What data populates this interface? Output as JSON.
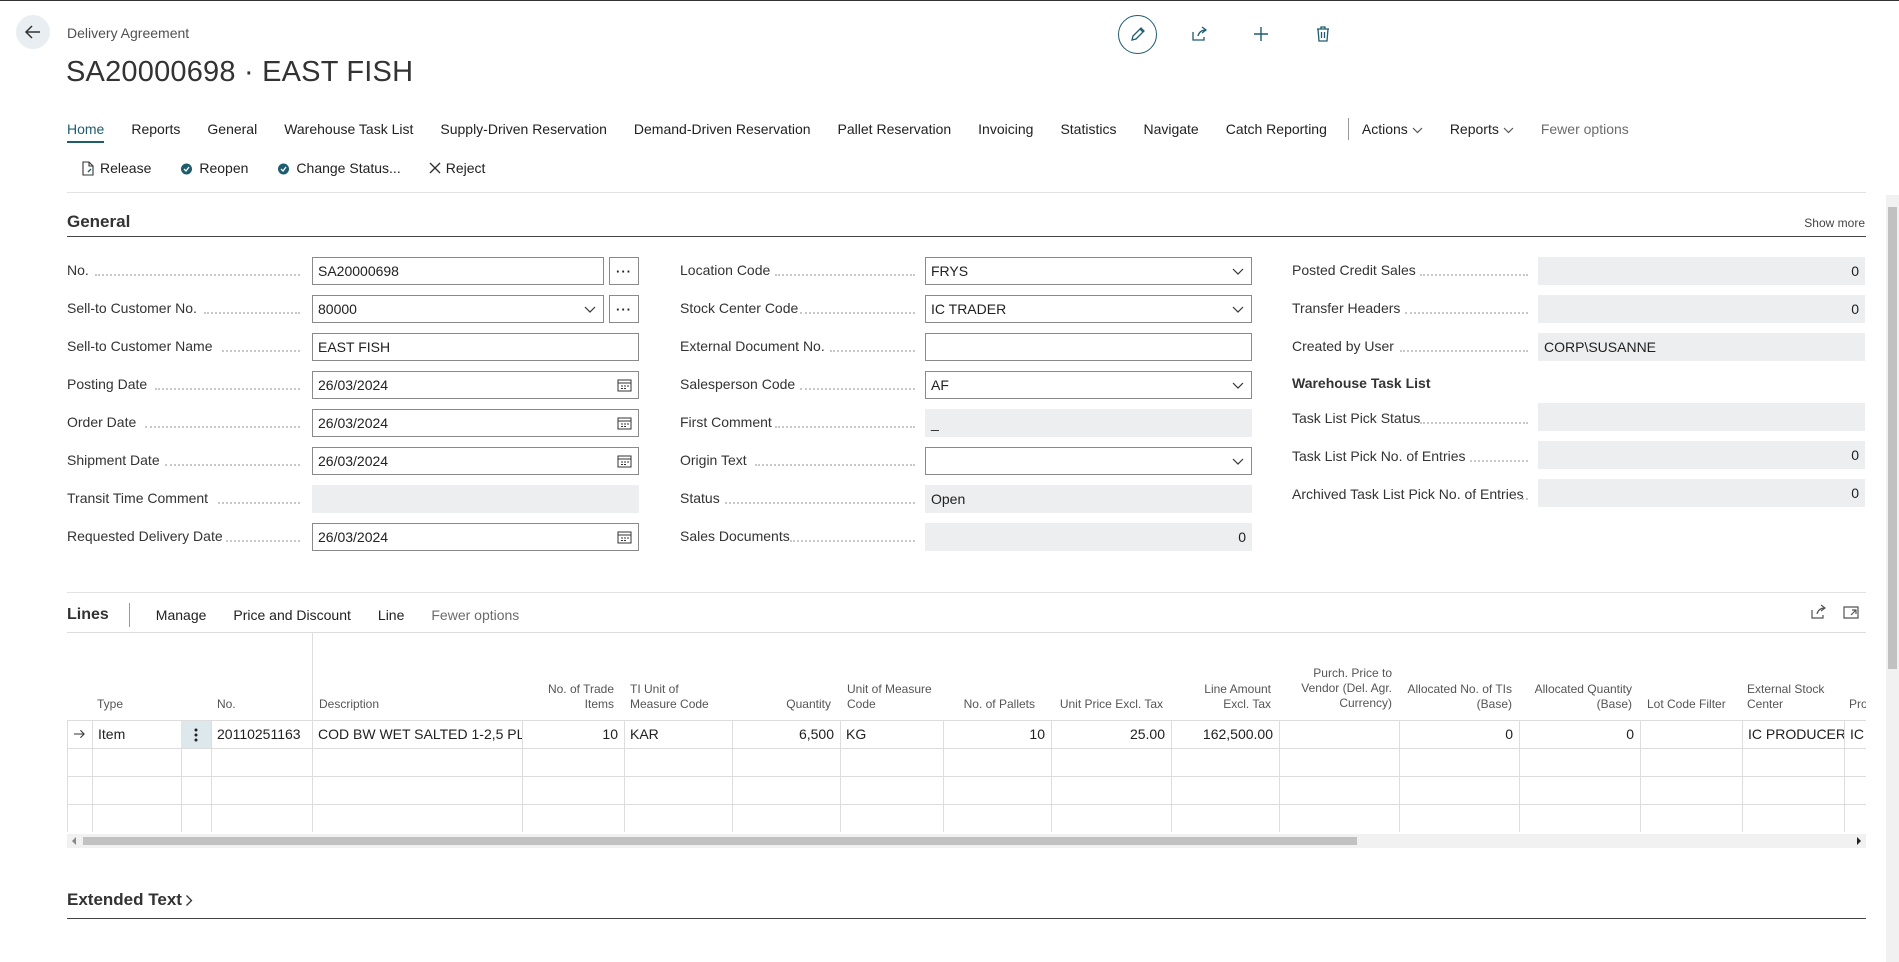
{
  "header": {
    "breadcrumb": "Delivery Agreement",
    "title": "SA20000698 · EAST FISH"
  },
  "nav": {
    "items": [
      "Home",
      "Reports",
      "General",
      "Warehouse Task List",
      "Supply-Driven Reservation",
      "Demand-Driven Reservation",
      "Pallet Reservation",
      "Invoicing",
      "Statistics",
      "Navigate",
      "Catch Reporting"
    ],
    "actions_menu": "Actions",
    "reports_menu": "Reports",
    "fewer": "Fewer options"
  },
  "actions": {
    "release": "Release",
    "reopen": "Reopen",
    "change_status": "Change Status...",
    "reject": "Reject"
  },
  "general": {
    "title": "General",
    "show_more": "Show more",
    "col1": {
      "no_label": "No.",
      "no_value": "SA20000698",
      "cust_no_label": "Sell-to Customer No.",
      "cust_no_value": "80000",
      "cust_name_label": "Sell-to Customer Name",
      "cust_name_value": "EAST FISH",
      "posting_label": "Posting Date",
      "posting_value": "26/03/2024",
      "order_label": "Order Date",
      "order_value": "26/03/2024",
      "ship_label": "Shipment Date",
      "ship_value": "26/03/2024",
      "transit_label": "Transit Time Comment",
      "transit_value": "",
      "req_label": "Requested Delivery Date",
      "req_value": "26/03/2024"
    },
    "col2": {
      "loc_label": "Location Code",
      "loc_value": "FRYS",
      "stock_label": "Stock Center Code",
      "stock_value": "IC TRADER",
      "extdoc_label": "External Document No.",
      "extdoc_value": "",
      "sales_label": "Salesperson Code",
      "sales_value": "AF",
      "comment_label": "First Comment",
      "comment_value": "_",
      "origin_label": "Origin Text",
      "origin_value": "",
      "status_label": "Status",
      "status_value": "Open",
      "salesdocs_label": "Sales Documents",
      "salesdocs_value": "0"
    },
    "col3": {
      "credit_label": "Posted Credit Sales",
      "credit_value": "0",
      "transfer_label": "Transfer Headers",
      "transfer_value": "0",
      "user_label": "Created by User",
      "user_value": "CORP\\SUSANNE",
      "wtl_heading": "Warehouse Task List",
      "pickstatus_label": "Task List Pick Status",
      "pickstatus_value": "",
      "pickentries_label": "Task List Pick No. of Entries",
      "pickentries_value": "0",
      "archived_label": "Archived Task List Pick No. of Entries",
      "archived_value": "0"
    }
  },
  "lines": {
    "title": "Lines",
    "menu": [
      "Manage",
      "Price and Discount",
      "Line"
    ],
    "fewer": "Fewer options",
    "headers": {
      "type": "Type",
      "no": "No.",
      "description": "Description",
      "trade_items": "No. of Trade Items",
      "ti_uom": "TI Unit of Measure Code",
      "quantity": "Quantity",
      "uom": "Unit of Measure Code",
      "pallets": "No. of Pallets",
      "unit_price": "Unit Price Excl. Tax",
      "line_amount": "Line Amount Excl. Tax",
      "purch_price": "Purch. Price to Vendor (Del. Agr. Currency)",
      "alloc_tis": "Allocated No. of TIs (Base)",
      "alloc_qty": "Allocated Quantity (Base)",
      "lot_filter": "Lot Code Filter",
      "ext_stock": "External Stock Center",
      "pro": "Pro"
    },
    "row": {
      "type": "Item",
      "no": "20110251163",
      "description": "COD BW WET SALTED 1-2,5 PL...",
      "trade_items": "10",
      "ti_uom": "KAR",
      "quantity": "6,500",
      "uom": "KG",
      "pallets": "10",
      "unit_price": "25.00",
      "line_amount": "162,500.00",
      "purch_price": "",
      "alloc_tis": "0",
      "alloc_qty": "0",
      "lot_filter": "",
      "ext_stock": "IC PRODUCER",
      "pro": "IC"
    }
  },
  "extended_text": {
    "title": "Extended Text"
  }
}
